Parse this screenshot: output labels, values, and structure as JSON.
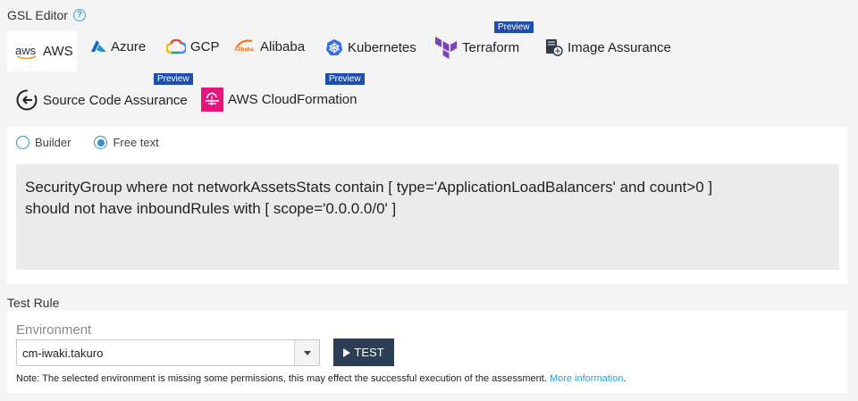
{
  "editor": {
    "title": "GSL Editor",
    "help_icon": "?"
  },
  "providers": {
    "aws": {
      "label": "AWS",
      "logo_text": "aws"
    },
    "azure": {
      "label": "Azure"
    },
    "gcp": {
      "label": "GCP"
    },
    "alibaba": {
      "label": "Alibaba",
      "logo_text": "Alibaba"
    },
    "kubernetes": {
      "label": "Kubernetes"
    },
    "terraform": {
      "label": "Terraform",
      "badge": "Preview"
    },
    "image_assurance": {
      "label": "Image Assurance"
    },
    "source_code_assurance": {
      "label": "Source Code Assurance",
      "badge": "Preview"
    },
    "aws_cloudformation": {
      "label": "AWS CloudFormation",
      "badge": "Preview"
    }
  },
  "mode": {
    "builder_label": "Builder",
    "free_text_label": "Free text",
    "selected": "free_text"
  },
  "rule_text": "SecurityGroup where not networkAssetsStats contain [ type='ApplicationLoadBalancers' and count>0 ]\nshould not have inboundRules with [ scope='0.0.0.0/0' ]",
  "test_rule": {
    "title": "Test Rule",
    "environment_label": "Environment",
    "environment_value": "cm-iwaki.takuro",
    "test_button_label": "TEST",
    "note": "Note: The selected environment is missing some permissions, this may effect the successful execution of the assessment.",
    "more_info_label": "More information",
    "note_suffix": "."
  },
  "colors": {
    "accent": "#3a8fc3",
    "preview_badge": "#1f4ea8",
    "test_button": "#2c3e55",
    "link": "#2a9fd6",
    "aws_orange": "#ff9900",
    "azure_blue": "#0a6cc4",
    "alibaba_orange": "#ff6a00",
    "kubernetes_blue": "#326ce5",
    "terraform_purple": "#7b42bc",
    "cloudformation_pink": "#e7157b"
  }
}
